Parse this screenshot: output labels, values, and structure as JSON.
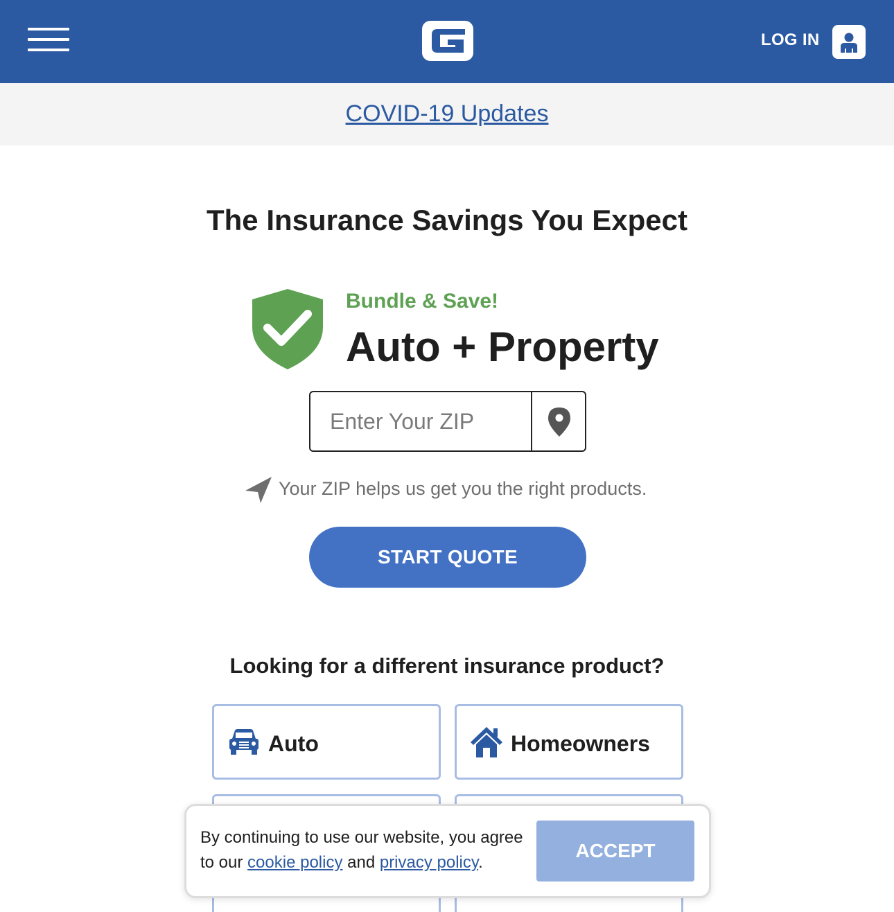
{
  "header": {
    "login_label": "LOG IN",
    "brand_color": "#2b5aa2",
    "icons": [
      "hamburger-menu-icon",
      "geico-logo",
      "user-icon"
    ]
  },
  "covid": {
    "link_label": "COVID-19 Updates"
  },
  "hero": {
    "headline": "The Insurance Savings You Expect",
    "bundle_tag": "Bundle & Save!",
    "product_title": "Auto + Property",
    "zip_placeholder": "Enter Your ZIP",
    "zip_value": "",
    "zip_hint": "Your ZIP helps us get you the right products.",
    "start_label": "START QUOTE",
    "accent_color": "#4372c4",
    "bundle_color": "#5ea152"
  },
  "products": {
    "heading": "Looking for a different insurance product?",
    "items": [
      {
        "label": "Auto",
        "icon": "car-icon"
      },
      {
        "label": "Homeowners",
        "icon": "house-icon"
      }
    ]
  },
  "cookie": {
    "text_before": "By continuing to use our website, you agree to our ",
    "cookie_link": "cookie policy",
    "text_middle": " and ",
    "privacy_link": "privacy policy",
    "text_after": ".",
    "accept_label": "ACCEPT"
  }
}
